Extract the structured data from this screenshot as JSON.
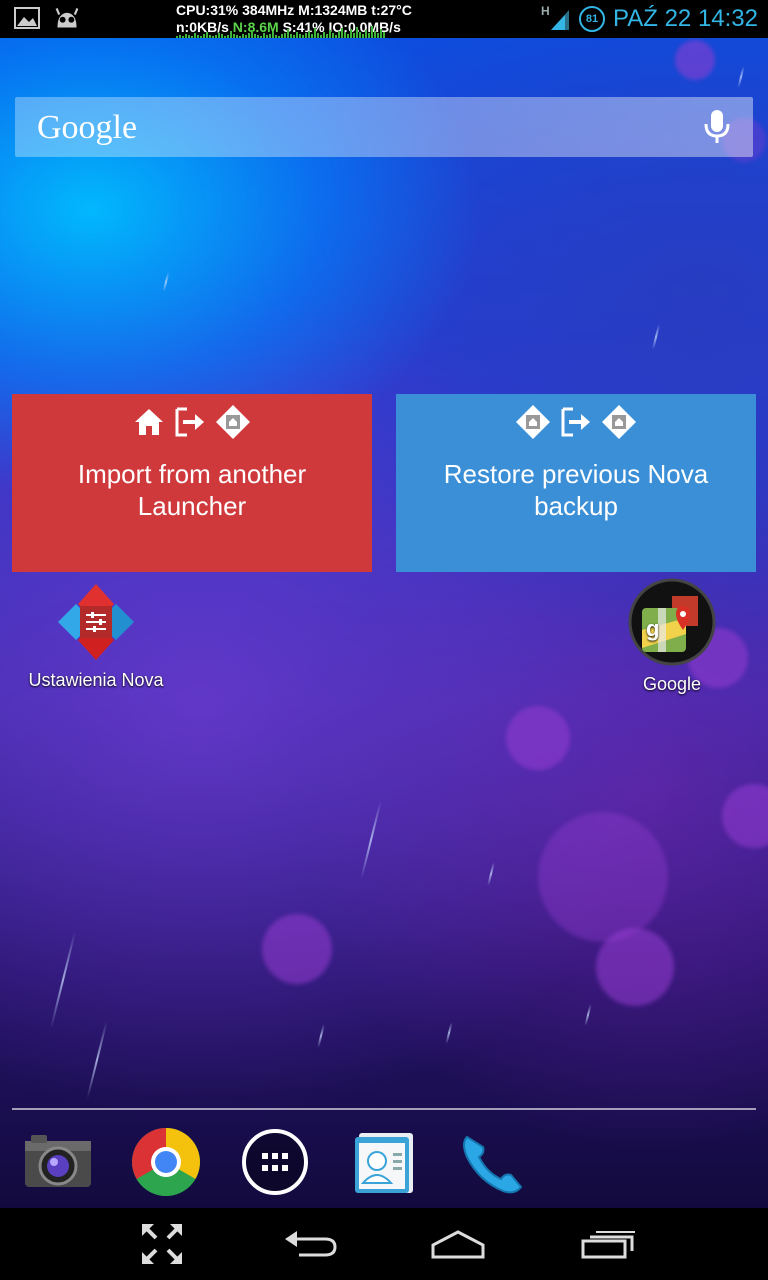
{
  "status_bar": {
    "stats_line1": "CPU:31% 384MHz M:1324MB t:27°C",
    "stats_line2_a": "n:0KB/s ",
    "stats_line2_b": "N:8.6M",
    "stats_line2_c": " S:41% IO:0.0MB/s",
    "network_type": "H",
    "battery_level": "81",
    "date_time": "PAŹ 22 14:32",
    "accent_color": "#33b5e5",
    "icons": [
      "gallery-notification-icon",
      "cyanogen-mascot-icon",
      "signal-icon",
      "battery-icon"
    ]
  },
  "search": {
    "logo_text": "Google",
    "icons": [
      "microphone-icon"
    ]
  },
  "tiles": {
    "import": {
      "label": "Import from another Launcher",
      "color": "#d0393c"
    },
    "restore": {
      "label": "Restore previous Nova backup",
      "color": "#3b8fd6"
    }
  },
  "apps": {
    "nova_settings": {
      "label": "Ustawienia Nova"
    },
    "google_folder": {
      "label": "Google"
    }
  },
  "dock": {
    "items": [
      "camera-icon",
      "chrome-icon",
      "app-drawer-icon",
      "contacts-icon",
      "phone-icon"
    ]
  },
  "nav": {
    "items": [
      "fullscreen-icon",
      "back-icon",
      "home-icon",
      "recents-icon"
    ]
  }
}
